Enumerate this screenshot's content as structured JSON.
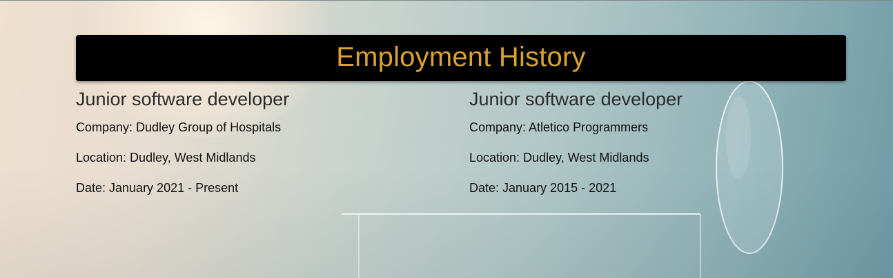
{
  "header": {
    "title": "Employment History"
  },
  "jobs": [
    {
      "title": "Junior software developer",
      "company": "Company: Dudley Group of Hospitals",
      "location": "Location: Dudley, West Midlands",
      "date": "Date: January 2021 - Present"
    },
    {
      "title": "Junior software developer",
      "company": "Company: Atletico Programmers",
      "location": "Location: Dudley, West Midlands",
      "date": "Date: January 2015 - 2021"
    }
  ],
  "colors": {
    "header_bg": "#000000",
    "header_text": "#d9a330",
    "body_text": "#111111"
  }
}
